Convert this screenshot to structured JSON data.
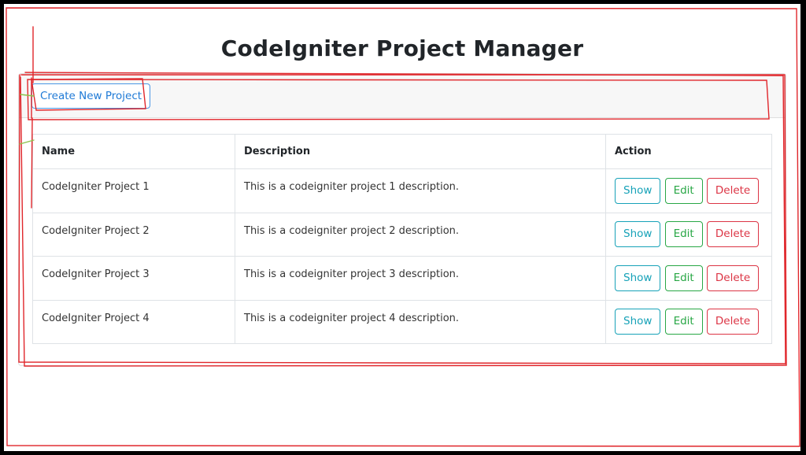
{
  "page": {
    "title": "CodeIgniter Project Manager",
    "create_button_label": "Create New Project"
  },
  "table": {
    "headers": {
      "name": "Name",
      "description": "Description",
      "action": "Action"
    },
    "rows": [
      {
        "name": "CodeIgniter Project 1",
        "description": "This is a codeigniter project 1 description."
      },
      {
        "name": "CodeIgniter Project 2",
        "description": "This is a codeigniter project 2 description."
      },
      {
        "name": "CodeIgniter Project 3",
        "description": "This is a codeigniter project 3 description."
      },
      {
        "name": "CodeIgniter Project 4",
        "description": "This is a codeigniter project 4 description."
      }
    ],
    "actions": {
      "show": "Show",
      "edit": "Edit",
      "delete": "Delete"
    }
  },
  "colors": {
    "primary": "#1f7ad6",
    "info": "#17a2b8",
    "success": "#28a745",
    "danger": "#dc3545",
    "annotation": "#e0262b"
  }
}
